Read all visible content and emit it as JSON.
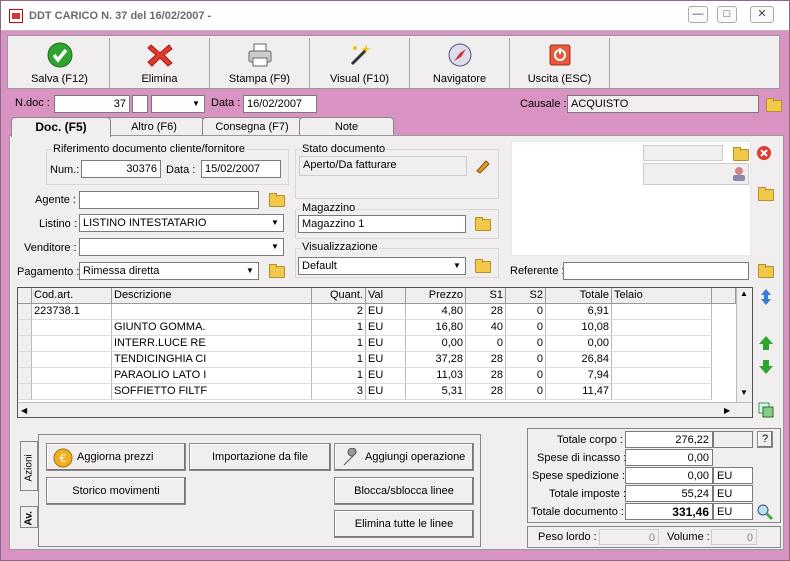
{
  "window": {
    "title": "DDT CARICO N. 37  del 16/02/2007 -",
    "controls": [
      "—",
      "□",
      "✕"
    ]
  },
  "toolbar": [
    {
      "label": "Salva (F12)",
      "icon": "check-icon",
      "name": "save-button"
    },
    {
      "label": "Elimina",
      "icon": "delete-x-icon",
      "name": "delete-button"
    },
    {
      "label": "Stampa (F9)",
      "icon": "printer-icon",
      "name": "print-button"
    },
    {
      "label": "Visual (F10)",
      "icon": "magic-wand-icon",
      "name": "visual-button"
    },
    {
      "label": "Navigatore",
      "icon": "compass-icon",
      "name": "navigator-button"
    },
    {
      "label": "Uscita (ESC)",
      "icon": "exit-icon",
      "name": "exit-button"
    }
  ],
  "header": {
    "ndoc_label": "N.doc :",
    "ndoc_value": "37",
    "data_label": "Data :",
    "data_value": "16/02/2007",
    "causale_label": "Causale :",
    "causale_value": "ACQUISTO"
  },
  "tabs": [
    "Doc. (F5)",
    "Altro (F6)",
    "Consegna (F7)",
    "Note"
  ],
  "doc": {
    "rif_title": "Riferimento documento cliente/fornitore",
    "num_label": "Num.:",
    "num_value": "30376",
    "data_label": "Data :",
    "data_value": "15/02/2007",
    "stato_title": "Stato documento",
    "stato_value": "Aperto/Da fatturare",
    "agente_label": "Agente :",
    "agente_value": "",
    "listino_label": "Listino :",
    "listino_value": "LISTINO INTESTATARIO",
    "venditore_label": "Venditore :",
    "venditore_value": "",
    "pagamento_label": "Pagamento :",
    "pagamento_value": "Rimessa diretta",
    "magazzino_title": "Magazzino",
    "magazzino_value": "Magazzino 1",
    "visual_title": "Visualizzazione",
    "visual_value": "Default",
    "referente_label": "Referente :",
    "referente_value": ""
  },
  "grid": {
    "headers": [
      "Cod.art.",
      "Descrizione",
      "Quant.",
      "Val",
      "Prezzo",
      "S1",
      "S2",
      "Totale",
      "Telaio"
    ],
    "rows": [
      [
        "223738.1",
        "",
        "2",
        "EU",
        "4,80",
        "28",
        "0",
        "6,91",
        ""
      ],
      [
        "",
        "GIUNTO GOMMA.",
        "1",
        "EU",
        "16,80",
        "40",
        "0",
        "10,08",
        ""
      ],
      [
        "",
        "INTERR.LUCE RE",
        "1",
        "EU",
        "0,00",
        "0",
        "0",
        "0,00",
        ""
      ],
      [
        "",
        "TENDICINGHIA CI",
        "1",
        "EU",
        "37,28",
        "28",
        "0",
        "26,84",
        ""
      ],
      [
        "",
        "PARAOLIO LATO I",
        "1",
        "EU",
        "11,03",
        "28",
        "0",
        "7,94",
        ""
      ],
      [
        "",
        "SOFFIETTO FILTF",
        "3",
        "EU",
        "5,31",
        "28",
        "0",
        "11,47",
        ""
      ]
    ]
  },
  "actions": {
    "vtab1": "Azioni",
    "vtab2": "Av.",
    "aggiorna": "Aggiorna prezzi",
    "importazione": "Importazione da file",
    "aggiungi": "Aggiungi operazione",
    "storico": "Storico movimenti",
    "blocca": "Blocca/sblocca linee",
    "elimina_linee": "Elimina tutte le linee"
  },
  "totals": {
    "corpo_label": "Totale corpo :",
    "corpo_value": "276,22",
    "help": "?",
    "incasso_label": "Spese di incasso :",
    "incasso_value": "0,00",
    "spedizione_label": "Spese spedizione :",
    "spedizione_value": "0,00",
    "spedizione_cur": "EU",
    "imposte_label": "Totale imposte :",
    "imposte_value": "55,24",
    "imposte_cur": "EU",
    "documento_label": "Totale documento :",
    "documento_value": "331,46",
    "documento_cur": "EU",
    "peso_label": "Peso lordo :",
    "peso_value": "0",
    "volume_label": "Volume :",
    "volume_value": "0"
  }
}
